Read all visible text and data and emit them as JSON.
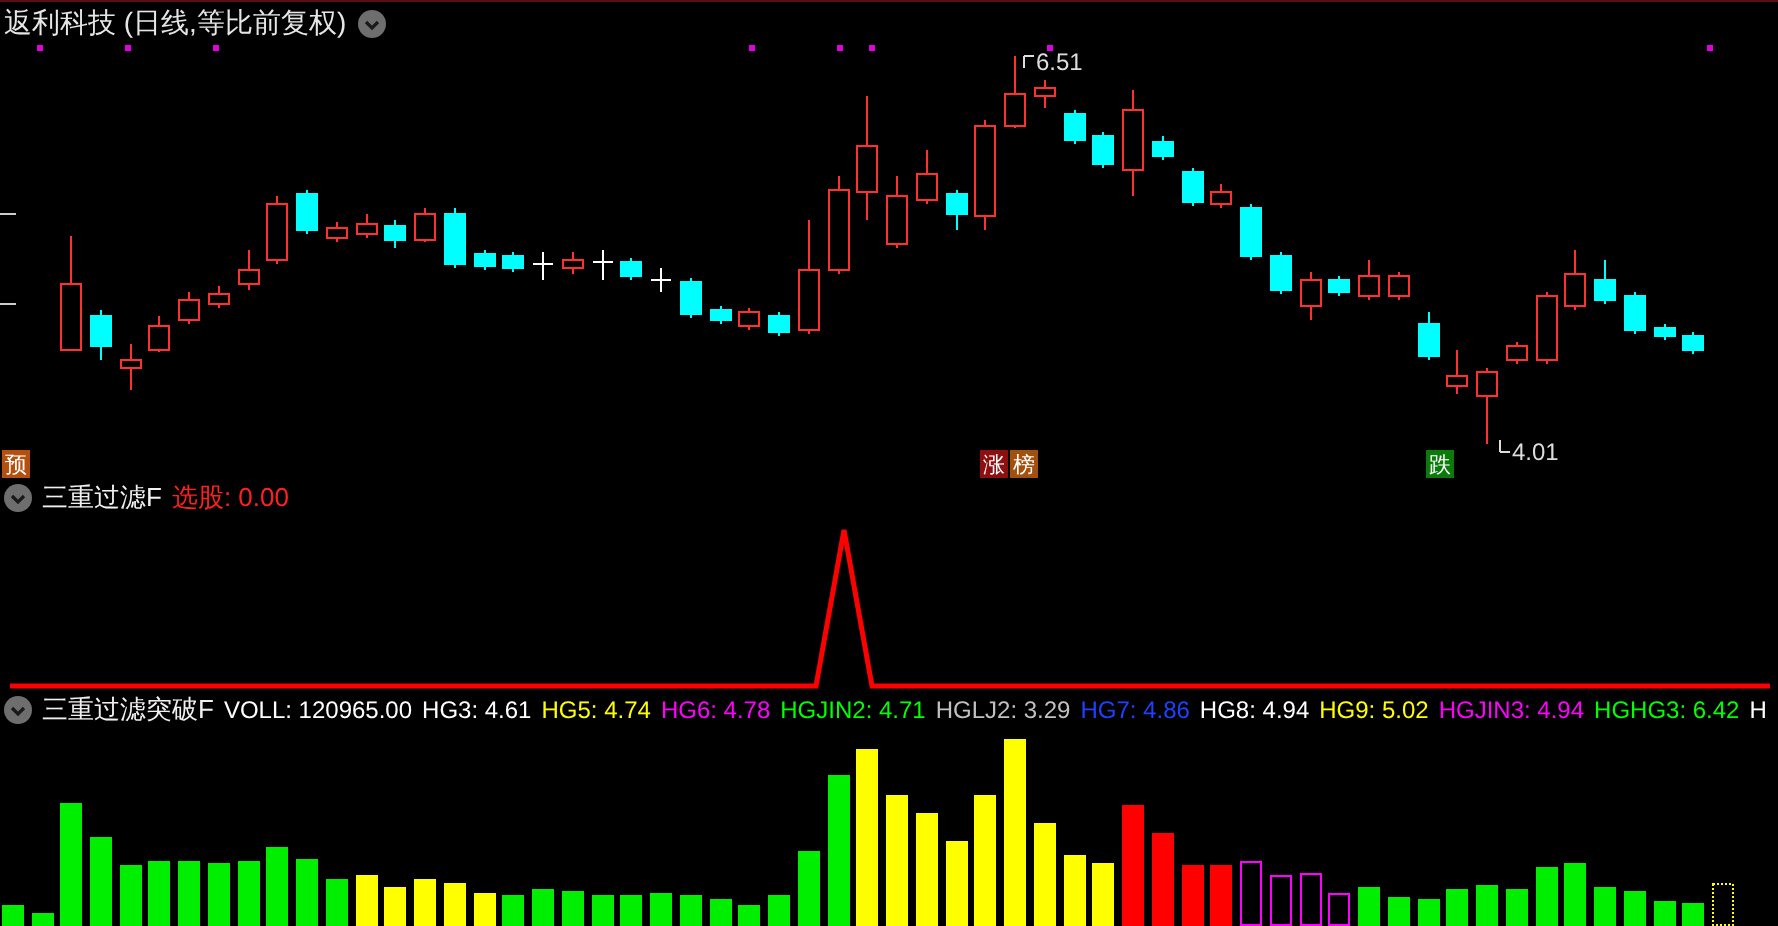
{
  "title": "返利科技 (日线,等比前复权)",
  "markers": [
    {
      "text": "预",
      "color": "#b4500f"
    },
    {
      "text": "涨",
      "color": "#8c1010"
    },
    {
      "text": "榜",
      "color": "#a0500f"
    },
    {
      "text": "跌",
      "color": "#0a7a0a"
    }
  ],
  "price_labels": {
    "high": "6.51",
    "low": "4.01"
  },
  "indicator_1": {
    "name": "三重过滤F",
    "reading": "选股: 0.00"
  },
  "indicator_2": {
    "name": "三重过滤突破F",
    "readings": [
      {
        "text": "VOLL: 120965.00",
        "color": "#ffffff"
      },
      {
        "text": "HG3: 4.61",
        "color": "#ffffff"
      },
      {
        "text": "HG5: 4.74",
        "color": "#ffff00"
      },
      {
        "text": "HG6: 4.78",
        "color": "#ff00ff"
      },
      {
        "text": "HGJIN2: 4.71",
        "color": "#00ff00"
      },
      {
        "text": "HGLJ2: 3.29",
        "color": "#c0c0c0"
      },
      {
        "text": "HG7: 4.86",
        "color": "#2040ff"
      },
      {
        "text": "HG8: 4.94",
        "color": "#ffffff"
      },
      {
        "text": "HG9: 5.02",
        "color": "#ffff00"
      },
      {
        "text": "HGJIN3: 4.94",
        "color": "#ff00ff"
      },
      {
        "text": "HGHG3: 6.42",
        "color": "#00ff00"
      },
      {
        "text": "H",
        "color": "#ffffff"
      }
    ]
  }
}
